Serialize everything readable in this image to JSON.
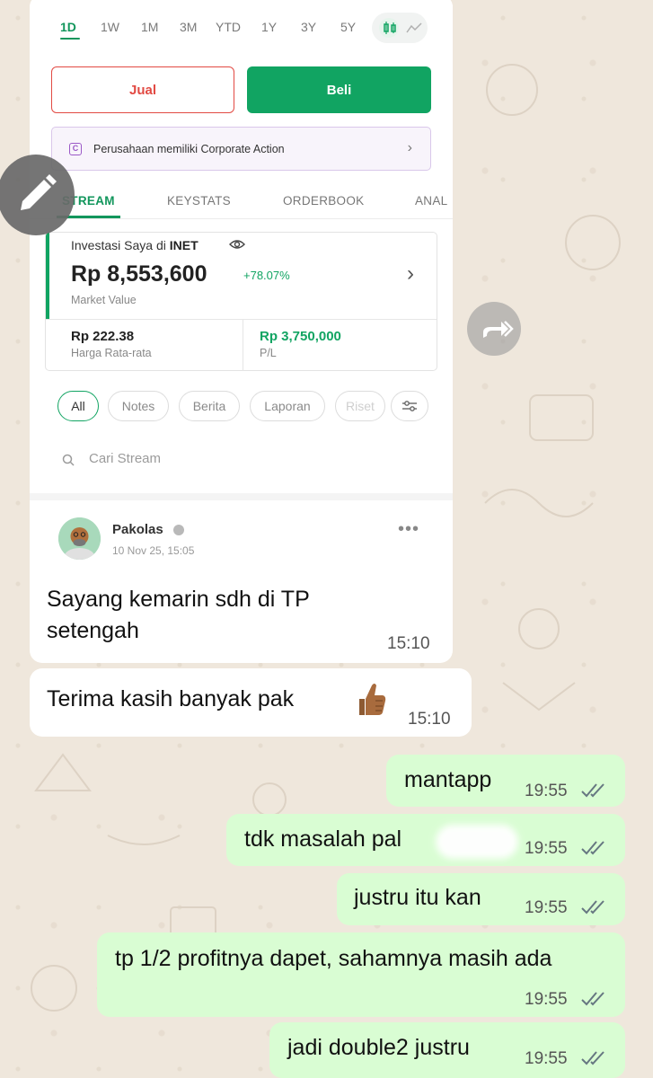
{
  "stock_screen": {
    "time_tabs": [
      "1D",
      "1W",
      "1M",
      "3M",
      "YTD",
      "1Y",
      "3Y",
      "5Y"
    ],
    "active_time_tab": "1D",
    "sell_label": "Jual",
    "buy_label": "Beli",
    "corporate_action_text": "Perusahaan memiliki Corporate Action",
    "sub_tabs": [
      "STREAM",
      "KEYSTATS",
      "ORDERBOOK",
      "ANAL"
    ],
    "investment": {
      "title": "Investasi Saya di",
      "ticker": "INET",
      "value": "Rp 8,553,600",
      "change_pct": "+78.07%",
      "value_label": "Market Value",
      "avg_price": "Rp 222.38",
      "avg_price_label": "Harga Rata-rata",
      "pl": "Rp 3,750,000",
      "pl_label": "P/L"
    },
    "filters": [
      "All",
      "Notes",
      "Berita",
      "Laporan",
      "Riset"
    ],
    "search_placeholder": "Cari Stream",
    "post": {
      "author": "Pakolas",
      "date": "10 Nov 25, 15:05"
    }
  },
  "chat": {
    "incoming": [
      {
        "text": "Sayang kemarin sdh di TP setengah",
        "time": "15:10"
      },
      {
        "text": "Terima kasih banyak pak",
        "time": "15:10"
      }
    ],
    "outgoing": [
      {
        "text": "mantapp",
        "time": "19:55"
      },
      {
        "text": "tdk masalah pal",
        "time": "19:55"
      },
      {
        "text": "justru itu kan",
        "time": "19:55"
      },
      {
        "text": "tp 1/2 profitnya dapet, sahamnya masih ada",
        "time": "19:55"
      },
      {
        "text": "jadi double2 justru",
        "time": "19:55"
      }
    ]
  },
  "colors": {
    "buy_green": "#11a462",
    "sell_red": "#e24a43",
    "outgoing_bubble": "#d9fdd3",
    "read_ticks": "#667781"
  }
}
